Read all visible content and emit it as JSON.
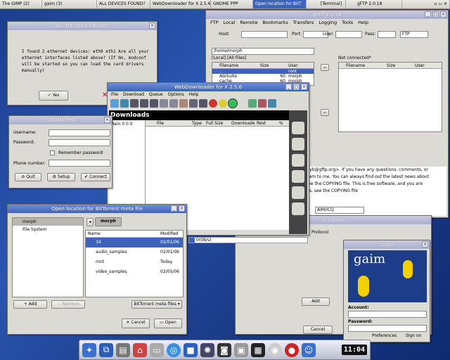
{
  "taskbar": [
    "The GIMP (2)",
    "gaim (3)",
    "ALL DEVICES FOUND?",
    "WebDownloader for X 2.5.6",
    "GNOME PPP",
    "Open location for BitT",
    "[Terminal]",
    "gFTP 2.0.18"
  ],
  "gftp": {
    "title": "gFTP 2.0.18",
    "menu": [
      "FTP",
      "Local",
      "Remote",
      "Bookmarks",
      "Transfers",
      "Logging",
      "Tools",
      "Help"
    ],
    "host_label": "Host:",
    "port_label": "Port:",
    "user_label": "User:",
    "pass_label": "Pass:",
    "protocol": "FTP",
    "local_path": "/home/morph",
    "local_status": "[Local] [All Files]",
    "not_connected": "Not connected*",
    "col_filename": "Filename",
    "col_size": "Size",
    "col_user": "User",
    "files": [
      {
        "name": "..",
        "size": "",
        "user": "root"
      },
      {
        "name": "AbiSuite",
        "size": "60",
        "user": "morph"
      },
      {
        "name": "cache",
        "size": "60",
        "user": "morph"
      }
    ],
    "log": [
      "<masneyb@gftp.org>. If you have any questions, comments, or",
      "email them to me. You can always find out the latest news about",
      "etails, see the COPYING file. This is free software, and you are",
      "or details, see the COPYING file"
    ],
    "aim": "AIM/ICQ",
    "accounts": "Accounts",
    "protocol_label": "Protocol",
    "add": "Add",
    "cancel": "Cancel"
  },
  "devices": {
    "title": "ALL DEVICES FOUND?",
    "message": "I found 2 ethernet devices: eth0 eth1 Are all your ethernet interfaces listed above? (If No, modconf will be started so you can load the card drivers manually)",
    "yes": "Yes"
  },
  "webdl": {
    "title": "WebDownloader for X 2.5.6",
    "menu": [
      "File",
      "Download",
      "Queue",
      "Options",
      "Help"
    ],
    "heading": "Downloads",
    "main": "Main",
    "nums": "0 0 0",
    "cols": [
      "File",
      "Type",
      "Full Size",
      "Downloade",
      "Rest",
      "%"
    ],
    "speed": "0(0B/s)"
  },
  "ppp": {
    "title": "GNOME PPP",
    "username": "Username:",
    "password": "Password:",
    "remember": "Remember password",
    "phone": "Phone number:",
    "quit": "Quit",
    "setup": "Setup",
    "connect": "Connect"
  },
  "bt": {
    "title": "Open location for BitTorrent meta file",
    "place_home": "morph",
    "place_fs": "File System",
    "crumb": "morph",
    "col_name": "Name",
    "col_modified": "Modified",
    "files": [
      {
        "name": "3d",
        "date": "02/01/06"
      },
      {
        "name": "audio_samples",
        "date": "02/01/06"
      },
      {
        "name": "mnt",
        "date": "Today"
      },
      {
        "name": "video_samples",
        "date": "02/05/06"
      }
    ],
    "add": "Add",
    "remove": "Remove",
    "filter": "BitTorrent meta files",
    "cancel": "Cancel",
    "open": "Open"
  },
  "gaim": {
    "title": "Login",
    "logo": "gaim",
    "account": "Account:",
    "password": "Password:",
    "preferences": "Preferences",
    "signon": "Sign on"
  },
  "clock": "11:04"
}
